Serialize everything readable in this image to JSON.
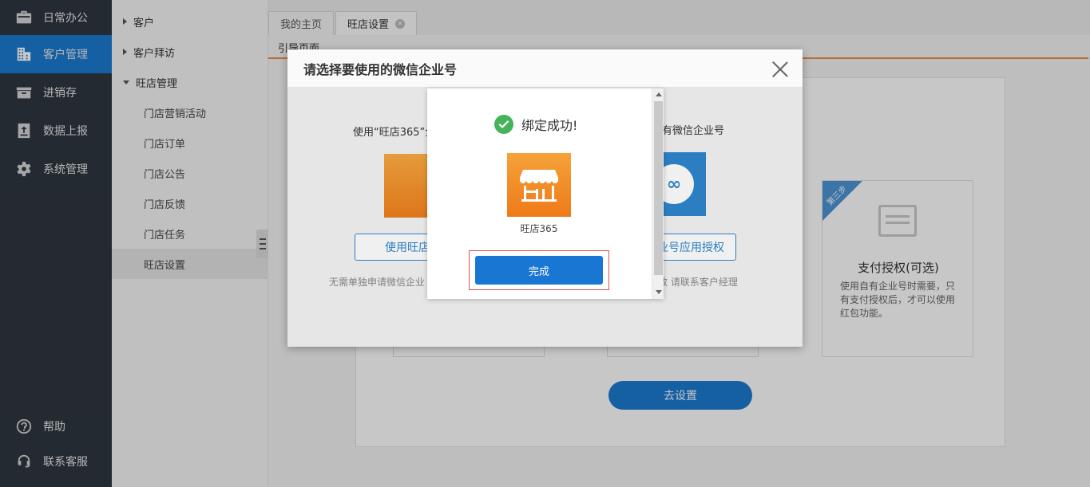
{
  "sidebar": {
    "items": [
      {
        "label": "日常办公",
        "icon": "briefcase-icon"
      },
      {
        "label": "客户管理",
        "icon": "building-icon",
        "active": true
      },
      {
        "label": "进销存",
        "icon": "box-icon"
      },
      {
        "label": "数据上报",
        "icon": "upload-icon"
      },
      {
        "label": "系统管理",
        "icon": "gear-icon"
      }
    ],
    "bottom": [
      {
        "label": "帮助",
        "icon": "help-icon"
      },
      {
        "label": "联系客服",
        "icon": "headset-icon"
      }
    ]
  },
  "submenu": {
    "groups": [
      {
        "label": "客户"
      },
      {
        "label": "客户拜访"
      },
      {
        "label": "旺店管理"
      }
    ],
    "items": [
      "门店营销活动",
      "门店订单",
      "门店公告",
      "门店反馈",
      "门店任务",
      "旺店设置"
    ]
  },
  "tabs": [
    {
      "label": "我的主页"
    },
    {
      "label": "旺店设置"
    }
  ],
  "page_label": "引导页面",
  "guide": {
    "step_ribbon": "第三步",
    "step_title": "支付授权(可选)",
    "step_desc": "使用自有企业号时需要，只有支付授权后，才可以使用红包功能。",
    "goto_label": "去设置"
  },
  "modal": {
    "title": "请选择要使用的微信企业号",
    "left_title": "使用“旺店365”企",
    "right_title": "自有微信企业号",
    "left_button": "使用旺店",
    "right_button": "业号应用授权",
    "left_note": "无需单独申请微信企业",
    "right_note": "效 请联系客户经理"
  },
  "dialog": {
    "success_text": "绑定成功!",
    "app_name": "旺店365",
    "done_label": "完成"
  }
}
